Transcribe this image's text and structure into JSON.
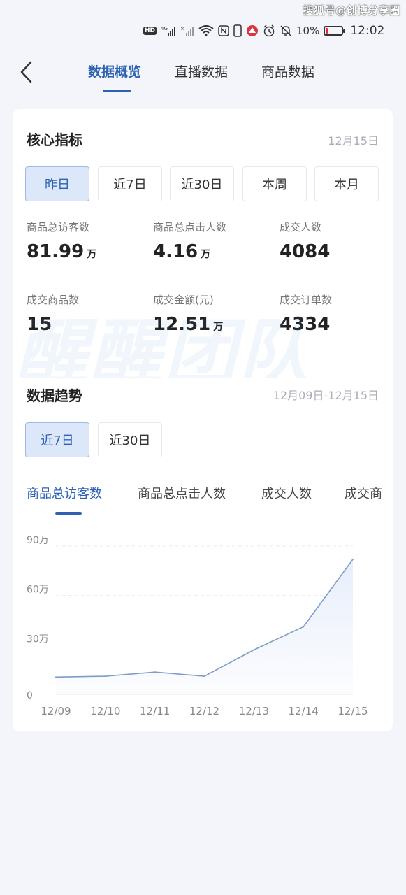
{
  "status_bar": {
    "watermark": "搜狐号@创博分享圈",
    "battery_pct": "10%",
    "battery_level": 0.1,
    "time": "12:02",
    "icons": [
      "hd-icon",
      "signal-4g-icon",
      "signal-x-icon",
      "wifi-icon",
      "nfc-icon",
      "phone-icon",
      "app-icon",
      "alarm-icon",
      "mute-icon",
      "battery-icon"
    ]
  },
  "header": {
    "tabs": [
      {
        "label": "数据概览",
        "active": true
      },
      {
        "label": "直播数据",
        "active": false
      },
      {
        "label": "商品数据",
        "active": false
      }
    ]
  },
  "core": {
    "title": "核心指标",
    "date": "12月15日",
    "periods": [
      {
        "label": "昨日",
        "active": true
      },
      {
        "label": "近7日",
        "active": false
      },
      {
        "label": "近30日",
        "active": false
      },
      {
        "label": "本周",
        "active": false
      },
      {
        "label": "本月",
        "active": false
      }
    ],
    "metrics": [
      {
        "label": "商品总访客数",
        "value": "81.99",
        "unit": "万"
      },
      {
        "label": "商品总点击人数",
        "value": "4.16",
        "unit": "万"
      },
      {
        "label": "成交人数",
        "value": "4084",
        "unit": ""
      },
      {
        "label": "成交商品数",
        "value": "15",
        "unit": ""
      },
      {
        "label": "成交金额(元)",
        "value": "12.51",
        "unit": "万"
      },
      {
        "label": "成交订单数",
        "value": "4334",
        "unit": ""
      }
    ]
  },
  "trend": {
    "title": "数据趋势",
    "date_range": "12月09日-12月15日",
    "periods": [
      {
        "label": "近7日",
        "active": true
      },
      {
        "label": "近30日",
        "active": false
      }
    ],
    "metric_tabs": [
      {
        "label": "商品总访客数",
        "active": true
      },
      {
        "label": "商品总点击人数",
        "active": false
      },
      {
        "label": "成交人数",
        "active": false
      },
      {
        "label": "成交商",
        "active": false
      }
    ]
  },
  "watermark_overlay": "醒醒团队",
  "chart_data": {
    "type": "area",
    "title": "",
    "xlabel": "",
    "ylabel": "",
    "categories": [
      "12/09",
      "12/10",
      "12/11",
      "12/12",
      "12/13",
      "12/14",
      "12/15"
    ],
    "values": [
      10.5,
      11.0,
      13.5,
      11.0,
      27.0,
      41.0,
      82.0
    ],
    "y_unit": "万",
    "ylim": [
      0,
      90
    ],
    "yticks": [
      {
        "value": 0,
        "label": "0"
      },
      {
        "value": 30,
        "label": "30万"
      },
      {
        "value": 60,
        "label": "60万"
      },
      {
        "value": 90,
        "label": "90万"
      }
    ],
    "grid": true,
    "colors": {
      "line": "#7c9cc9",
      "fill": "#e8eefb"
    }
  }
}
